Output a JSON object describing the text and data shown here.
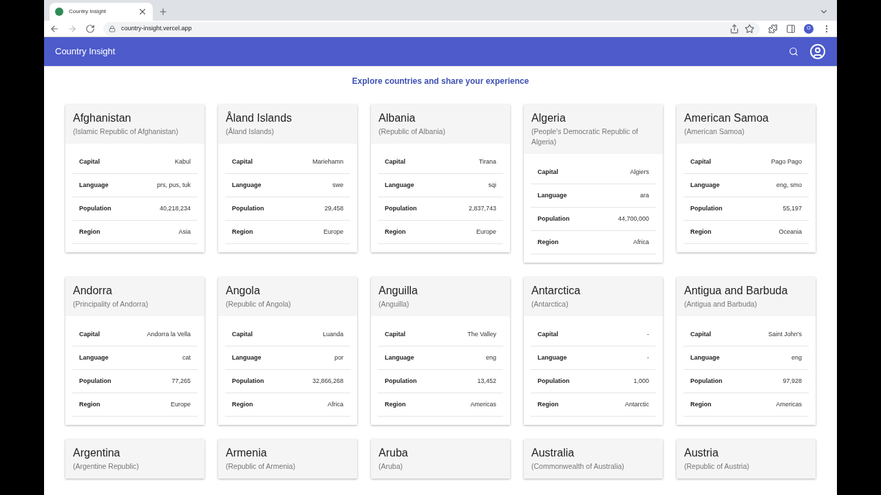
{
  "browser": {
    "tab_title": "Country Insight",
    "url": "country-insight.vercel.app",
    "profile_initial": "O"
  },
  "app_bar": {
    "title": "Country Insight"
  },
  "heading": "Explore countries and share your experience",
  "cards": [
    {
      "name": "Afghanistan",
      "official_name": "(Islamic Republic of Afghanistan)",
      "fields": [
        {
          "label": "Capital",
          "value": "Kabul"
        },
        {
          "label": "Language",
          "value": "prs, pus, tuk"
        },
        {
          "label": "Population",
          "value": "40,218,234"
        },
        {
          "label": "Region",
          "value": "Asia"
        }
      ]
    },
    {
      "name": "Åland Islands",
      "official_name": "(Åland Islands)",
      "fields": [
        {
          "label": "Capital",
          "value": "Mariehamn"
        },
        {
          "label": "Language",
          "value": "swe"
        },
        {
          "label": "Population",
          "value": "29,458"
        },
        {
          "label": "Region",
          "value": "Europe"
        }
      ]
    },
    {
      "name": "Albania",
      "official_name": "(Republic of Albania)",
      "fields": [
        {
          "label": "Capital",
          "value": "Tirana"
        },
        {
          "label": "Language",
          "value": "sqi"
        },
        {
          "label": "Population",
          "value": "2,837,743"
        },
        {
          "label": "Region",
          "value": "Europe"
        }
      ]
    },
    {
      "name": "Algeria",
      "official_name": "(People's Democratic Republic of Algeria)",
      "fields": [
        {
          "label": "Capital",
          "value": "Algiers"
        },
        {
          "label": "Language",
          "value": "ara"
        },
        {
          "label": "Population",
          "value": "44,700,000"
        },
        {
          "label": "Region",
          "value": "Africa"
        }
      ]
    },
    {
      "name": "American Samoa",
      "official_name": "(American Samoa)",
      "fields": [
        {
          "label": "Capital",
          "value": "Pago Pago"
        },
        {
          "label": "Language",
          "value": "eng, smo"
        },
        {
          "label": "Population",
          "value": "55,197"
        },
        {
          "label": "Region",
          "value": "Oceania"
        }
      ]
    },
    {
      "name": "Andorra",
      "official_name": "(Principality of Andorra)",
      "fields": [
        {
          "label": "Capital",
          "value": "Andorra la Vella"
        },
        {
          "label": "Language",
          "value": "cat"
        },
        {
          "label": "Population",
          "value": "77,265"
        },
        {
          "label": "Region",
          "value": "Europe"
        }
      ]
    },
    {
      "name": "Angola",
      "official_name": "(Republic of Angola)",
      "fields": [
        {
          "label": "Capital",
          "value": "Luanda"
        },
        {
          "label": "Language",
          "value": "por"
        },
        {
          "label": "Population",
          "value": "32,866,268"
        },
        {
          "label": "Region",
          "value": "Africa"
        }
      ]
    },
    {
      "name": "Anguilla",
      "official_name": "(Anguilla)",
      "fields": [
        {
          "label": "Capital",
          "value": "The Valley"
        },
        {
          "label": "Language",
          "value": "eng"
        },
        {
          "label": "Population",
          "value": "13,452"
        },
        {
          "label": "Region",
          "value": "Americas"
        }
      ]
    },
    {
      "name": "Antarctica",
      "official_name": "(Antarctica)",
      "fields": [
        {
          "label": "Capital",
          "value": "-"
        },
        {
          "label": "Language",
          "value": "-"
        },
        {
          "label": "Population",
          "value": "1,000"
        },
        {
          "label": "Region",
          "value": "Antarctic"
        }
      ]
    },
    {
      "name": "Antigua and Barbuda",
      "official_name": "(Antigua and Barbuda)",
      "fields": [
        {
          "label": "Capital",
          "value": "Saint John's"
        },
        {
          "label": "Language",
          "value": "eng"
        },
        {
          "label": "Population",
          "value": "97,928"
        },
        {
          "label": "Region",
          "value": "Americas"
        }
      ]
    },
    {
      "name": "Argentina",
      "official_name": "(Argentine Republic)"
    },
    {
      "name": "Armenia",
      "official_name": "(Republic of Armenia)"
    },
    {
      "name": "Aruba",
      "official_name": "(Aruba)"
    },
    {
      "name": "Australia",
      "official_name": "(Commonwealth of Australia)"
    },
    {
      "name": "Austria",
      "official_name": "(Republic of Austria)"
    }
  ]
}
